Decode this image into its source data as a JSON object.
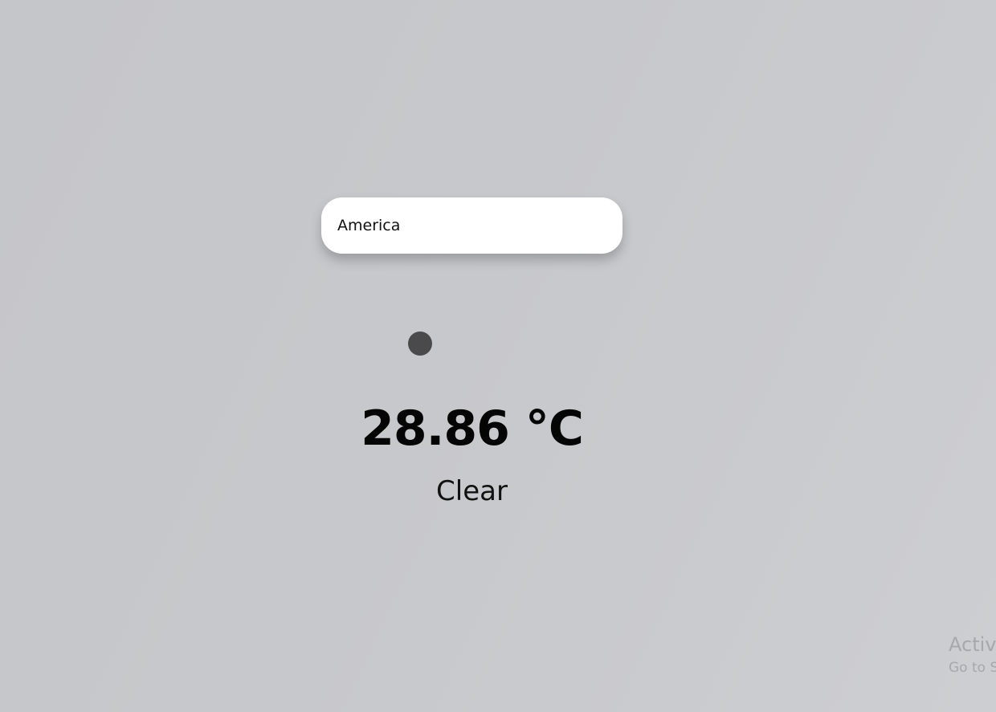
{
  "search": {
    "value": "America",
    "placeholder": ""
  },
  "weather": {
    "icon": "weather-icon",
    "temperature": "28.86 °C",
    "condition": "Clear"
  },
  "watermark": {
    "title": "Activa",
    "subtitle": "Go to S"
  },
  "colors": {
    "background": "#c7c8cb",
    "search_bg": "#ffffff",
    "icon": "#4a4a4c",
    "watermark": "#a7a8ab"
  }
}
